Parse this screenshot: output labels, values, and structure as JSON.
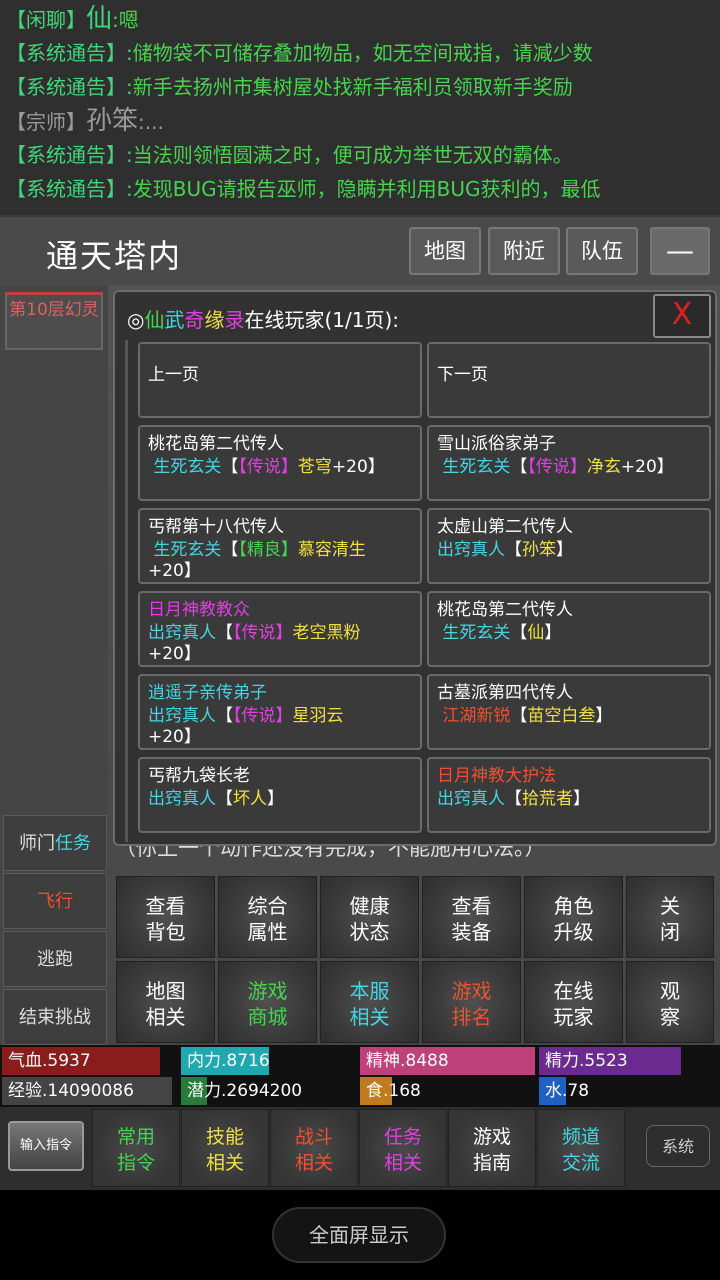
{
  "chat": [
    {
      "channel": "【闲聊】",
      "name": "仙",
      "colon": ":",
      "msg": "嗯"
    },
    {
      "channel": "【系统通告】",
      "colon": ":",
      "msg": "储物袋不可储存叠加物品，如无空间戒指，请减少数"
    },
    {
      "channel": "【系统通告】",
      "colon": ":",
      "msg": "新手去扬州市集树屋处找新手福利员领取新手奖励"
    },
    {
      "channel": "【宗师】",
      "name": "孙笨",
      "colon": ":",
      "msg": "..."
    },
    {
      "channel": "【系统通告】",
      "colon": ":",
      "msg": "当法则领悟圆满之时，便可成为举世无双的霸体。"
    },
    {
      "channel": "【系统通告】",
      "colon": ":",
      "msg": "发现BUG请报告巫师，隐瞒并利用BUG获利的，最低"
    }
  ],
  "location": {
    "title": "通天塔内",
    "map_btn": "地图",
    "nearby_btn": "附近",
    "team_btn": "队伍",
    "minus_btn": "—"
  },
  "left": {
    "room_btn": "第10层幻灵",
    "master_task": "师门",
    "master_task_2": "任务",
    "fly": "飞行",
    "escape": "逃跑",
    "end_challenge": "结束挑战"
  },
  "dialog": {
    "prefix": "◎",
    "t1": "仙",
    "t2": "武",
    "t3": "奇",
    "t4": "缘",
    "t5": "录",
    "title_rest": "在线玩家(1/1页):",
    "close": "X",
    "prev": "上一页",
    "next": "下一页",
    "players": [
      {
        "line1": "桃花岛第二代传人",
        "rank": "生死玄关",
        "q": "【传说】",
        "name": "苍穹",
        "plus": "+20】"
      },
      {
        "line1": "雪山派俗家弟子",
        "rank": "生死玄关",
        "q": "【传说】",
        "name": "净玄",
        "plus": "+20】"
      },
      {
        "line1": "丐帮第十八代传人",
        "rank": "生死玄关",
        "q": "【精良】",
        "name": "慕容清生",
        "plus": "+20】"
      },
      {
        "line1": "太虚山第二代传人",
        "rank": "出窍真人",
        "name": "孙笨",
        "close": "】"
      },
      {
        "line1": "日月神教教众",
        "rank": "出窍真人",
        "q": "【传说】",
        "name": "老空黑粉",
        "plus": "+20】"
      },
      {
        "line1": "桃花岛第二代传人",
        "rank": "生死玄关",
        "name": "仙",
        "close": "】"
      },
      {
        "line1": "逍遥子亲传弟子",
        "rank": "出窍真人",
        "q": "【传说】",
        "name": "星羽云",
        "plus": "+20】"
      },
      {
        "line1": "古墓派第四代传人",
        "rank": "江湖新锐",
        "name": "苗空白叁",
        "close": "】"
      },
      {
        "line1": "丐帮九袋长老",
        "rank": "出窍真人",
        "name": "坏人",
        "close": "】"
      },
      {
        "line1": "日月神教大护法",
        "rank": "出窍真人",
        "name": "拾荒者",
        "close": "】"
      }
    ]
  },
  "under_text": "（你上一个动作还没有完成，不能施用心法。）",
  "grid": [
    {
      "l1": "查看",
      "l2": "背包"
    },
    {
      "l1": "综合",
      "l2": "属性"
    },
    {
      "l1": "健康",
      "l2": "状态"
    },
    {
      "l1": "查看",
      "l2": "装备"
    },
    {
      "l1": "角色",
      "l2": "升级"
    },
    {
      "l1": "关",
      "l2": "闭"
    },
    {
      "l1": "地图",
      "l2": "相关"
    },
    {
      "l1": "游戏",
      "l2": "商城"
    },
    {
      "l1": "本服",
      "l2": "相关"
    },
    {
      "l1": "游戏",
      "l2": "排名"
    },
    {
      "l1": "在线",
      "l2": "玩家"
    },
    {
      "l1": "观",
      "l2": "察"
    }
  ],
  "stats": {
    "hp": "气血.5937",
    "hp_fill": 0.93,
    "neili": "内力.8716",
    "neili_fill": 0.5,
    "jingshen": "精神.8488",
    "jingshen_fill": 1.0,
    "jingli": "精力.5523",
    "jingli_fill": 0.8,
    "exp": "经验.14090086",
    "qianli": "潜力.2694200",
    "qianli_fill": 0.15,
    "food": "食.168",
    "food_fill": 0.18,
    "water": "水.78",
    "water_fill": 0.15
  },
  "bottom": [
    {
      "l1": "常用",
      "l2": "指令"
    },
    {
      "l1": "技能",
      "l2": "相关"
    },
    {
      "l1": "战斗",
      "l2": "相关"
    },
    {
      "l1": "任务",
      "l2": "相关"
    },
    {
      "l1": "游戏",
      "l2": "指南"
    },
    {
      "l1": "频道",
      "l2": "交流"
    }
  ],
  "input_btn": "输入指令",
  "sys_btn": "系统",
  "fullscreen": "全面屏显示",
  "colors": {
    "green": "#46d34e",
    "cyan": "#43d6e0",
    "magenta": "#e040e0",
    "yellow": "#f0e040",
    "red": "#f05030"
  }
}
